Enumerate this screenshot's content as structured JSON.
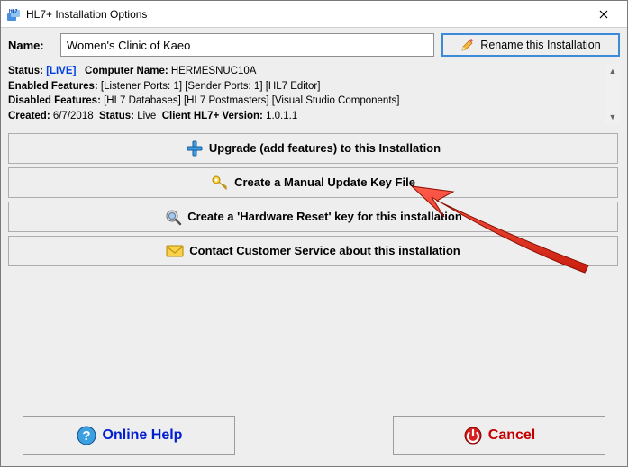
{
  "window": {
    "title": "HL7+ Installation Options"
  },
  "name_row": {
    "label": "Name:",
    "value": "Women's Clinic of Kaeo",
    "rename_btn": "Rename this Installation"
  },
  "info": {
    "status_label": "Status:",
    "status_value": "[LIVE]",
    "computer_label": "Computer Name:",
    "computer_value": "HERMESNUC10A",
    "enabled_label": "Enabled Features:",
    "enabled_value": "[Listener Ports: 1] [Sender Ports: 1] [HL7 Editor]",
    "disabled_label": "Disabled Features:",
    "disabled_value": "[HL7 Databases] [HL7 Postmasters] [Visual Studio Components]",
    "created_label": "Created:",
    "created_value": "6/7/2018",
    "status2_label": "Status:",
    "status2_value": "Live",
    "client_ver_label": "Client HL7+ Version:",
    "client_ver_value": "1.0.1.1"
  },
  "buttons": {
    "upgrade": "Upgrade (add features) to this Installation",
    "manual_key": "Create a Manual Update Key File",
    "hw_reset": "Create a 'Hardware Reset' key for this installation",
    "contact": "Contact Customer Service about this installation"
  },
  "footer": {
    "help": "Online Help",
    "cancel": "Cancel"
  }
}
